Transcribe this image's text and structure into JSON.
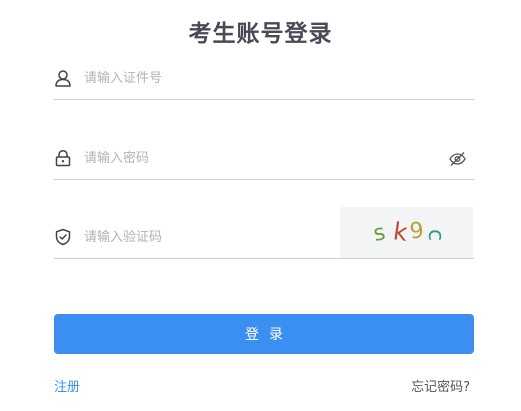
{
  "title": "考生账号登录",
  "fields": {
    "id_number": {
      "placeholder": "请输入证件号",
      "value": "",
      "icon": "user-icon"
    },
    "password": {
      "placeholder": "请输入密码",
      "value": "",
      "icon": "lock-icon",
      "toggle_icon": "eye-hidden-icon"
    },
    "captcha": {
      "placeholder": "请输入验证码",
      "value": "",
      "icon": "shield-check-icon",
      "image_text": "sk9c"
    }
  },
  "login_button": "登录",
  "links": {
    "register": "注册",
    "forgot_password": "忘记密码?"
  },
  "colors": {
    "primary": "#3b8ff0",
    "title": "#4a4a57",
    "placeholder": "#b2b2b8",
    "border": "#cfcfd4"
  }
}
